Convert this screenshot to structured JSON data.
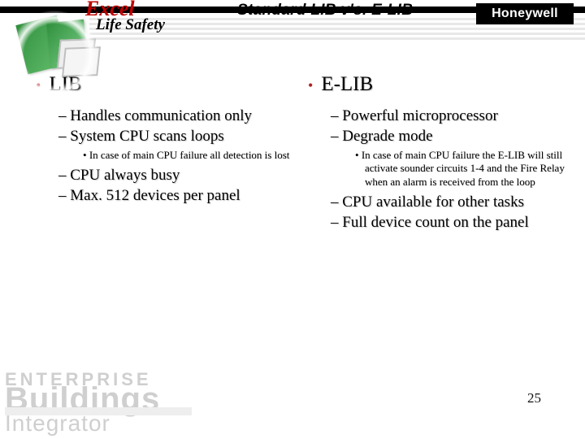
{
  "header": {
    "product": "Excel",
    "subproduct": "Life Safety",
    "slide_title": "Standard LIB  v's. E-LIB",
    "brand": "Honeywell"
  },
  "left": {
    "title": "LIB",
    "items": [
      "Handles communication only",
      "System CPU scans loops"
    ],
    "sub": [
      "In case of main CPU failure all detection is lost"
    ],
    "items2": [
      "CPU always busy",
      "Max. 512 devices per panel"
    ]
  },
  "right": {
    "title": "E-LIB",
    "items": [
      "Powerful microprocessor",
      "Degrade mode"
    ],
    "sub": [
      "In case of main CPU failure the E-LIB will still activate sounder circuits 1-4 and the Fire Relay when an alarm is received from the loop"
    ],
    "items2": [
      "CPU available for other tasks",
      "Full device count on the panel"
    ]
  },
  "footer": {
    "wm1": "ENTERPRISE",
    "wm2": "Buildings",
    "wm3": "Integrator",
    "page": "25"
  }
}
